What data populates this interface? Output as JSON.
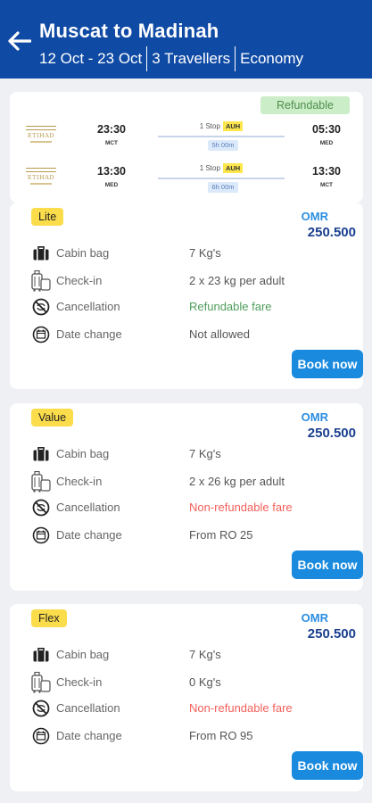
{
  "header": {
    "title": "Muscat to Madinah",
    "dates": "12 Oct - 23 Oct",
    "travellers": "3 Travellers",
    "cabin": "Economy",
    "bg_color": "#0f4aa4"
  },
  "flight": {
    "refund_badge": "Refundable",
    "airline_logo_text": "ETIHAD",
    "legs": [
      {
        "dep_time": "23:30",
        "dep_code": "MCT",
        "stops": "1 Stop",
        "via": "AUH",
        "duration": "5h 00m",
        "arr_time": "05:30",
        "arr_code": "MED"
      },
      {
        "dep_time": "13:30",
        "dep_code": "MED",
        "stops": "1 Stop",
        "via": "AUH",
        "duration": "6h 00m",
        "arr_time": "13:30",
        "arr_code": "MCT"
      }
    ]
  },
  "fares": [
    {
      "name": "Lite",
      "currency": "OMR",
      "price": "250.500",
      "rows": [
        {
          "icon": "cabin-bag-icon",
          "label": "Cabin bag",
          "value": "7 Kg's"
        },
        {
          "icon": "check-in-icon",
          "label": "Check-in",
          "value": "2 x 23 kg per adult"
        },
        {
          "icon": "cancellation-icon",
          "label": "Cancellation",
          "value": "Refundable fare"
        },
        {
          "icon": "date-change-icon",
          "label": "Date change",
          "value": "Not allowed"
        }
      ],
      "button": "Book now"
    },
    {
      "name": "Value",
      "currency": "OMR",
      "price": "250.500",
      "rows": [
        {
          "icon": "cabin-bag-icon",
          "label": "Cabin bag",
          "value": "7 Kg's"
        },
        {
          "icon": "check-in-icon",
          "label": "Check-in",
          "value": "2 x 26 kg per adult"
        },
        {
          "icon": "cancellation-icon",
          "label": "Cancellation",
          "value": "Non-refundable fare"
        },
        {
          "icon": "date-change-icon",
          "label": "Date change",
          "value": "From RO 25"
        }
      ],
      "button": "Book now"
    },
    {
      "name": "Flex",
      "currency": "OMR",
      "price": "250.500",
      "rows": [
        {
          "icon": "cabin-bag-icon",
          "label": "Cabin bag",
          "value": "7 Kg's"
        },
        {
          "icon": "check-in-icon",
          "label": "Check-in",
          "value": "0 Kg's"
        },
        {
          "icon": "cancellation-icon",
          "label": "Cancellation",
          "value": "Non-refundable fare"
        },
        {
          "icon": "date-change-icon",
          "label": "Date change",
          "value": "From RO 95"
        }
      ],
      "button": "Book now"
    }
  ],
  "colors": {
    "accent": "#1a8ade",
    "badge_yellow": "#fbdc4b",
    "refundable_green": "#4d9e5a",
    "nonrefundable_red": "#f2605b"
  }
}
